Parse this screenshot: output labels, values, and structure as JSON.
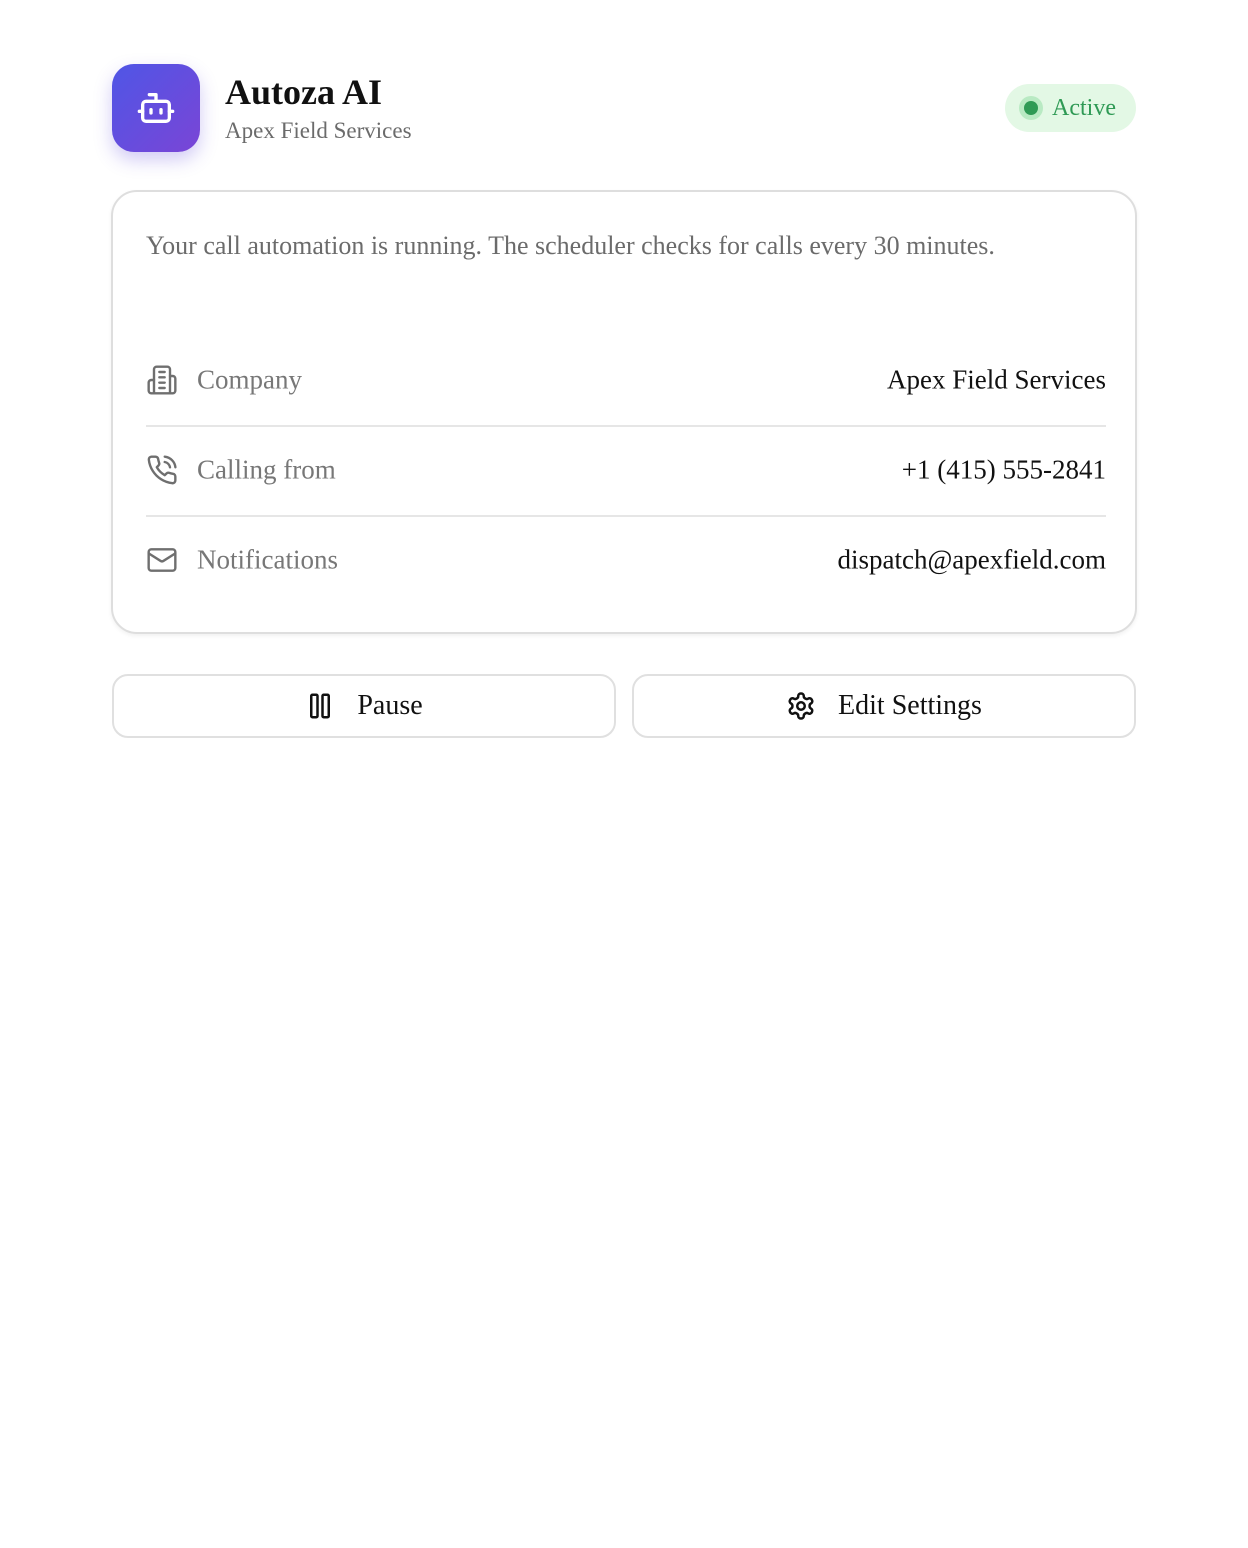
{
  "header": {
    "app_name": "Autoza AI",
    "company_subtitle": "Apex Field Services",
    "logo_icon": "robot-icon",
    "status": {
      "label": "Active",
      "color": "#2f9a55"
    }
  },
  "card": {
    "description": "Your call automation is running. The scheduler checks for calls every 30 minutes.",
    "rows": [
      {
        "icon": "building-icon",
        "label": "Company",
        "value": "Apex Field Services"
      },
      {
        "icon": "phone-calling-icon",
        "label": "Calling from",
        "value": "+1 (415) 555-2841"
      },
      {
        "icon": "mail-icon",
        "label": "Notifications",
        "value": "dispatch@apexfield.com"
      }
    ]
  },
  "actions": {
    "pause": {
      "label": "Pause",
      "icon": "pause-icon"
    },
    "settings": {
      "label": "Edit Settings",
      "icon": "gear-icon"
    }
  },
  "colors": {
    "accent_gradient_start": "#4f56e6",
    "accent_gradient_end": "#7a45d6",
    "status_background": "#e3f8e5"
  }
}
